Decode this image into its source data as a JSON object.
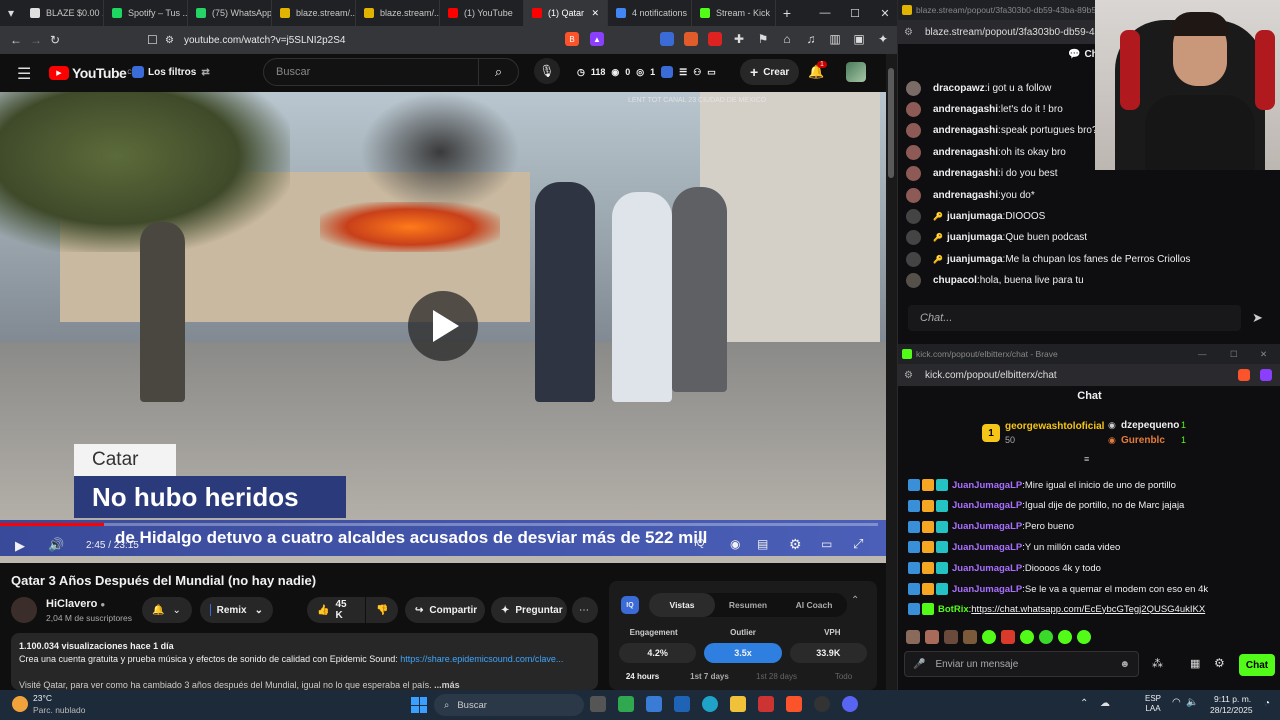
{
  "tabs": [
    {
      "label": "BLAZE $0.00 ...",
      "color": "#e0e0e0"
    },
    {
      "label": "Spotify – Tus ...",
      "color": "#1ed760"
    },
    {
      "label": "(75) WhatsApp",
      "color": "#25d366"
    },
    {
      "label": "blaze.stream/...",
      "color": "#e0b400"
    },
    {
      "label": "blaze.stream/...",
      "color": "#e0b400"
    },
    {
      "label": "(1) YouTube",
      "color": "#ff0000"
    },
    {
      "label": "(1) Qatar",
      "color": "#ff0000"
    },
    {
      "label": "4 notifications",
      "color": "#4285f4"
    },
    {
      "label": "Stream - Kick",
      "color": "#53fc18"
    }
  ],
  "url": "youtube.com/watch?v=j5SLNI2p2S4",
  "yt": {
    "logo": "YouTube",
    "country": "CO",
    "filters": "Los filtros",
    "search_placeholder": "Buscar",
    "stats": {
      "a": "118",
      "b": "0",
      "c": "1"
    },
    "create": "Crear",
    "notif_count": "1"
  },
  "video": {
    "lower_label": "Catar",
    "headline": "No hubo heridos",
    "ticker": "de Hidalgo detuvo a cuatro alcaldes acusados de desviar más de 522 mill",
    "channel_bug": "LENT TOT CANAL 23 CIUDAD DE MEXICO",
    "time": "2:45 / 23:15",
    "progress": 0.119
  },
  "title": "Qatar 3 Años Después del Mundial (no hay nadie)",
  "channel": {
    "name": "HiClavero",
    "subs": "2,04 M de suscriptores"
  },
  "actions": {
    "remix": "Remix",
    "likes": "45 K",
    "share": "Compartir",
    "ask": "Preguntar"
  },
  "desc": {
    "views": "1.100.034 visualizaciones  hace 1 día",
    "line1": "Crea una cuenta gratuita y prueba música y efectos de sonido de calidad con Epidemic Sound:",
    "link": "https://share.epidemicsound.com/clave...",
    "line2": "Visité Qatar, para ver como ha cambiado 3 años después del Mundial, igual no lo que esperaba el país.",
    "more": "...más"
  },
  "iq": {
    "tabs": [
      "Vistas",
      "Resumen",
      "AI Coach"
    ],
    "metrics": [
      {
        "label": "Engagement",
        "value": "4.2%"
      },
      {
        "label": "Outlier",
        "value": "3.5x"
      },
      {
        "label": "VPH",
        "value": "33.9K"
      }
    ],
    "periods": [
      "24 hours",
      "1st 7 days",
      "1st 28 days",
      "Todo"
    ]
  },
  "blaze": {
    "url": "blaze.stream/popout/3fa303b0-db59-43ba-89b5-9",
    "chat_title": "Ch",
    "messages": [
      {
        "user": "dracopawz",
        "text": "i got u a follow",
        "av": "#7a6b66"
      },
      {
        "user": "andrenagashi",
        "text": "let's do it ! bro",
        "av": "#8d5a55"
      },
      {
        "user": "andrenagashi",
        "text": "speak portugues bro?",
        "av": "#8d5a55"
      },
      {
        "user": "andrenagashi",
        "text": "oh its okay bro",
        "av": "#8d5a55"
      },
      {
        "user": "andrenagashi",
        "text": "i do you best",
        "av": "#8d5a55"
      },
      {
        "user": "andrenagashi",
        "text": "you do*",
        "av": "#8d5a55"
      },
      {
        "user": "juanjumaga",
        "text": "DIOOOS",
        "av": "#444"
      },
      {
        "user": "juanjumaga",
        "text": "Que buen podcast",
        "av": "#444"
      },
      {
        "user": "juanjumaga",
        "text": "Me la chupan los fanes de Perros Criollos",
        "av": "#444"
      },
      {
        "user": "chupacol",
        "text": "hola, buena live para tu",
        "av": "#55504a"
      }
    ],
    "input_placeholder": "Chat..."
  },
  "kick": {
    "window_title": "kick.com/popout/elbitterx/chat - Brave",
    "url": "kick.com/popout/elbitterx/chat",
    "chat_title": "Chat",
    "leader1": {
      "name": "georgewashtoloficial",
      "amount": "50",
      "rank": "1"
    },
    "leader2": {
      "name": "dzepequeno",
      "amount": "1"
    },
    "leader3": {
      "name": "Gurenblc",
      "amount": "1"
    },
    "messages": [
      {
        "user": "JuanJumagaLP",
        "text": "Mire igual el inicio de uno de portillo"
      },
      {
        "user": "JuanJumagaLP",
        "text": "Igual dije de portillo, no de Marc jajaja"
      },
      {
        "user": "JuanJumagaLP",
        "text": "Pero bueno"
      },
      {
        "user": "JuanJumagaLP",
        "text": "Y un millón cada video"
      },
      {
        "user": "JuanJumagaLP",
        "text": "Dioooos 4k y todo"
      },
      {
        "user": "JuanJumagaLP",
        "text": "Se le va a quemar el modem con eso en 4k"
      }
    ],
    "bot": {
      "user": "BotRix",
      "text": "https://chat.whatsapp.com/EcEybcGTegj2QUSG4ukIKX"
    },
    "input_placeholder": "Enviar un mensaje",
    "send": "Chat"
  },
  "taskbar": {
    "weather_temp": "23°C",
    "weather_desc": "Parc. nublado",
    "search": "Buscar",
    "lang": "ESP",
    "lang2": "LAA",
    "time": "9:11 p. m.",
    "date": "28/12/2025"
  }
}
